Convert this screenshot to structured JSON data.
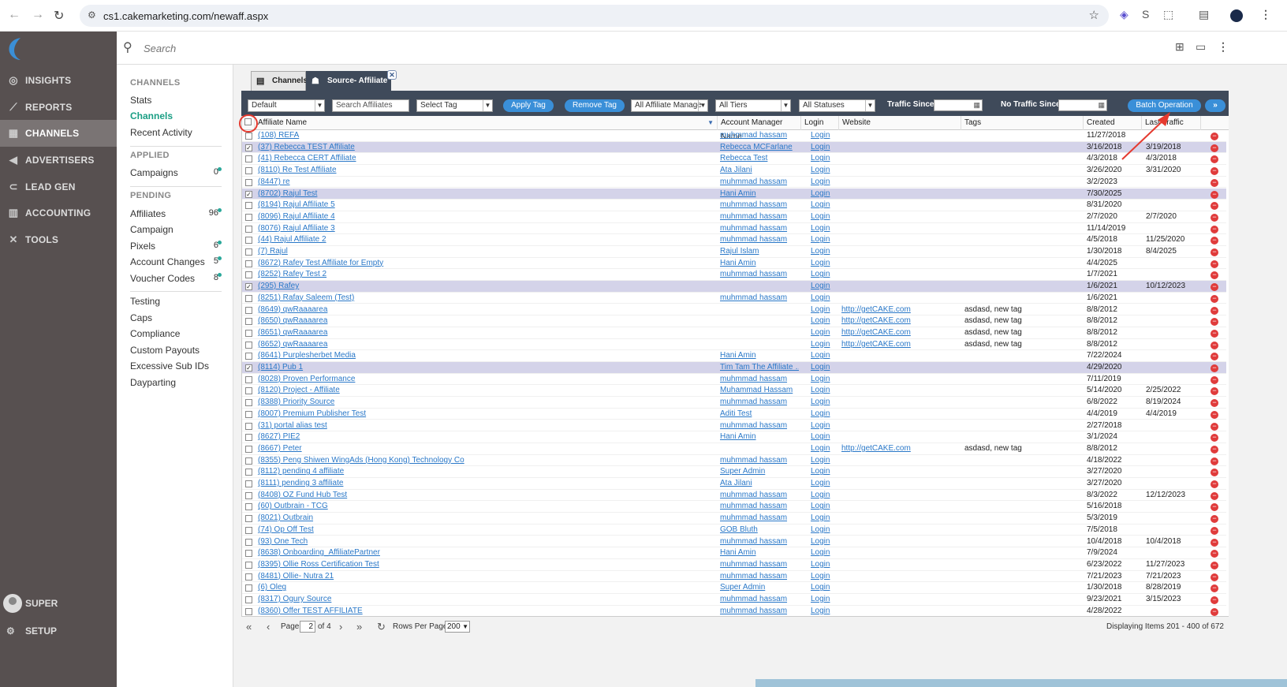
{
  "browser": {
    "url": "cs1.cakemarketing.com/newaff.aspx"
  },
  "sidebar": {
    "items": [
      {
        "label": "INSIGHTS",
        "icon": "insights-icon"
      },
      {
        "label": "REPORTS",
        "icon": "reports-icon"
      },
      {
        "label": "CHANNELS",
        "icon": "channels-icon"
      },
      {
        "label": "ADVERTISERS",
        "icon": "megaphone-icon"
      },
      {
        "label": "LEAD GEN",
        "icon": "magnet-icon"
      },
      {
        "label": "ACCOUNTING",
        "icon": "calculator-icon"
      },
      {
        "label": "TOOLS",
        "icon": "tools-icon"
      }
    ],
    "user": "SUPER",
    "setup": "SETUP"
  },
  "search": {
    "placeholder": "Search"
  },
  "subnav": {
    "channels_head": "CHANNELS",
    "stats": "Stats",
    "channels": "Channels",
    "recent": "Recent Activity",
    "applied_head": "APPLIED",
    "campaigns": "Campaigns",
    "campaigns_count": "0",
    "pending_head": "PENDING",
    "affiliates": "Affiliates",
    "affiliates_count": "96",
    "campaign": "Campaign",
    "pixels": "Pixels",
    "pixels_count": "6",
    "account_changes": "Account Changes",
    "account_changes_count": "5",
    "voucher": "Voucher Codes",
    "voucher_count": "8",
    "testing": "Testing",
    "caps": "Caps",
    "compliance": "Compliance",
    "custom_payouts": "Custom Payouts",
    "excessive": "Excessive Sub IDs",
    "dayparting": "Dayparting"
  },
  "tabs": {
    "channels": "Channels",
    "source": "Source- Affiliate"
  },
  "toolbar": {
    "view": "Default",
    "search_placeholder": "Search Affiliates",
    "select_tag": "Select Tag",
    "apply_tag": "Apply Tag",
    "remove_tag": "Remove Tag",
    "account_manager": "All Affiliate Manage",
    "tiers": "All Tiers",
    "statuses": "All Statuses",
    "traffic_since": "Traffic Since",
    "no_traffic_since": "No Traffic Since",
    "batch": "Batch Operation",
    "more": "»"
  },
  "grid": {
    "headers": {
      "name": "Affiliate Name",
      "manager": "Account Manager Name",
      "login": "Login",
      "website": "Website",
      "tags": "Tags",
      "created": "Created",
      "last": "Last Traffic"
    },
    "rows": [
      {
        "name": "(108) REFA",
        "manager": "muhmmad hassam",
        "login": "Login",
        "website": "",
        "tags": "",
        "created": "11/27/2018",
        "last": "",
        "checked": false
      },
      {
        "name": "(37) Rebecca TEST Affiliate",
        "manager": "Rebecca MCFarlane",
        "login": "Login",
        "website": "",
        "tags": "",
        "created": "3/16/2018",
        "last": "3/19/2018",
        "checked": true
      },
      {
        "name": "(41) Rebecca CERT Affiliate",
        "manager": "Rebecca Test",
        "login": "Login",
        "website": "",
        "tags": "",
        "created": "4/3/2018",
        "last": "4/3/2018",
        "checked": false
      },
      {
        "name": "(8110) Re Test Affiliate",
        "manager": "Ata Jilani",
        "login": "Login",
        "website": "",
        "tags": "",
        "created": "3/26/2020",
        "last": "3/31/2020",
        "checked": false
      },
      {
        "name": "(8447) re",
        "manager": "muhmmad hassam",
        "login": "Login",
        "website": "",
        "tags": "",
        "created": "3/2/2023",
        "last": "",
        "checked": false
      },
      {
        "name": "(8702) Rajul Test",
        "manager": "Hani Amin",
        "login": "Login",
        "website": "",
        "tags": "",
        "created": "7/30/2025",
        "last": "",
        "checked": true
      },
      {
        "name": "(8194) Rajul Affiliate 5",
        "manager": "muhmmad hassam",
        "login": "Login",
        "website": "",
        "tags": "",
        "created": "8/31/2020",
        "last": "",
        "checked": false
      },
      {
        "name": "(8096) Rajul Affiliate 4",
        "manager": "muhmmad hassam",
        "login": "Login",
        "website": "",
        "tags": "",
        "created": "2/7/2020",
        "last": "2/7/2020",
        "checked": false
      },
      {
        "name": "(8076) Rajul Affiliate 3",
        "manager": "muhmmad hassam",
        "login": "Login",
        "website": "",
        "tags": "",
        "created": "11/14/2019",
        "last": "",
        "checked": false
      },
      {
        "name": "(44) Rajul Affiliate 2",
        "manager": "muhmmad hassam",
        "login": "Login",
        "website": "",
        "tags": "",
        "created": "4/5/2018",
        "last": "11/25/2020",
        "checked": false
      },
      {
        "name": "(7) Rajul",
        "manager": "Rajul Islam",
        "login": "Login",
        "website": "",
        "tags": "",
        "created": "1/30/2018",
        "last": "8/4/2025",
        "checked": false
      },
      {
        "name": "(8672) Rafey Test Affiliate for Empty",
        "manager": "Hani Amin",
        "login": "Login",
        "website": "",
        "tags": "",
        "created": "4/4/2025",
        "last": "",
        "checked": false
      },
      {
        "name": "(8252) Rafey Test 2",
        "manager": "muhmmad hassam",
        "login": "Login",
        "website": "",
        "tags": "",
        "created": "1/7/2021",
        "last": "",
        "checked": false
      },
      {
        "name": "(295) Rafey",
        "manager": "",
        "login": "Login",
        "website": "",
        "tags": "",
        "created": "1/6/2021",
        "last": "10/12/2023",
        "checked": true
      },
      {
        "name": "(8251) Rafay Saleem (Test)",
        "manager": "muhmmad hassam",
        "login": "Login",
        "website": "",
        "tags": "",
        "created": "1/6/2021",
        "last": "",
        "checked": false
      },
      {
        "name": "(8649) qwRaaaarea",
        "manager": "",
        "login": "Login",
        "website": "http://getCAKE.com",
        "tags": "asdasd, new tag",
        "created": "8/8/2012",
        "last": "",
        "checked": false
      },
      {
        "name": "(8650) qwRaaaarea",
        "manager": "",
        "login": "Login",
        "website": "http://getCAKE.com",
        "tags": "asdasd, new tag",
        "created": "8/8/2012",
        "last": "",
        "checked": false
      },
      {
        "name": "(8651) qwRaaaarea",
        "manager": "",
        "login": "Login",
        "website": "http://getCAKE.com",
        "tags": "asdasd, new tag",
        "created": "8/8/2012",
        "last": "",
        "checked": false
      },
      {
        "name": "(8652) qwRaaaarea",
        "manager": "",
        "login": "Login",
        "website": "http://getCAKE.com",
        "tags": "asdasd, new tag",
        "created": "8/8/2012",
        "last": "",
        "checked": false
      },
      {
        "name": "(8641) Purplesherbet Media",
        "manager": "Hani Amin",
        "login": "Login",
        "website": "",
        "tags": "",
        "created": "7/22/2024",
        "last": "",
        "checked": false
      },
      {
        "name": "(8114) Pub 1",
        "manager": "Tim Tam The Affiliate …",
        "login": "Login",
        "website": "",
        "tags": "",
        "created": "4/29/2020",
        "last": "",
        "checked": true
      },
      {
        "name": "(8028) Proven Performance",
        "manager": "muhmmad hassam",
        "login": "Login",
        "website": "",
        "tags": "",
        "created": "7/11/2019",
        "last": "",
        "checked": false
      },
      {
        "name": "(8120) Project - Affiliate",
        "manager": "Muhammad Hassam",
        "login": "Login",
        "website": "",
        "tags": "",
        "created": "5/14/2020",
        "last": "2/25/2022",
        "checked": false
      },
      {
        "name": "(8388) Priority Source",
        "manager": "muhmmad hassam",
        "login": "Login",
        "website": "",
        "tags": "",
        "created": "6/8/2022",
        "last": "8/19/2024",
        "checked": false
      },
      {
        "name": "(8007) Premium Publisher Test",
        "manager": "Aditi Test",
        "login": "Login",
        "website": "",
        "tags": "",
        "created": "4/4/2019",
        "last": "4/4/2019",
        "checked": false
      },
      {
        "name": "(31) portal alias test",
        "manager": "muhmmad hassam",
        "login": "Login",
        "website": "",
        "tags": "",
        "created": "2/27/2018",
        "last": "",
        "checked": false
      },
      {
        "name": "(8627) PIE2",
        "manager": "Hani Amin",
        "login": "Login",
        "website": "",
        "tags": "",
        "created": "3/1/2024",
        "last": "",
        "checked": false
      },
      {
        "name": "(8667) Peter",
        "manager": "",
        "login": "Login",
        "website": "http://getCAKE.com",
        "tags": "asdasd, new tag",
        "created": "8/8/2012",
        "last": "",
        "checked": false
      },
      {
        "name": "(8355) Peng Shiwen WingAds (Hong Kong) Technology Co",
        "manager": "muhmmad hassam",
        "login": "Login",
        "website": "",
        "tags": "",
        "created": "4/18/2022",
        "last": "",
        "checked": false
      },
      {
        "name": "(8112) pending 4 affiliate",
        "manager": "Super Admin",
        "login": "Login",
        "website": "",
        "tags": "",
        "created": "3/27/2020",
        "last": "",
        "checked": false
      },
      {
        "name": "(8111) pending 3 affiliate",
        "manager": "Ata Jilani",
        "login": "Login",
        "website": "",
        "tags": "",
        "created": "3/27/2020",
        "last": "",
        "checked": false
      },
      {
        "name": "(8408) OZ Fund Hub Test",
        "manager": "muhmmad hassam",
        "login": "Login",
        "website": "",
        "tags": "",
        "created": "8/3/2022",
        "last": "12/12/2023",
        "checked": false
      },
      {
        "name": "(60) Outbrain - TCG",
        "manager": "muhmmad hassam",
        "login": "Login",
        "website": "",
        "tags": "",
        "created": "5/16/2018",
        "last": "",
        "checked": false
      },
      {
        "name": "(8021) Outbrain",
        "manager": "muhmmad hassam",
        "login": "Login",
        "website": "",
        "tags": "",
        "created": "5/3/2019",
        "last": "",
        "checked": false
      },
      {
        "name": "(74) Op Off Test",
        "manager": "GOB Bluth",
        "login": "Login",
        "website": "",
        "tags": "",
        "created": "7/5/2018",
        "last": "",
        "checked": false
      },
      {
        "name": "(93) One Tech",
        "manager": "muhmmad hassam",
        "login": "Login",
        "website": "",
        "tags": "",
        "created": "10/4/2018",
        "last": "10/4/2018",
        "checked": false
      },
      {
        "name": "(8638) Onboarding_AffiliatePartner",
        "manager": "Hani Amin",
        "login": "Login",
        "website": "",
        "tags": "",
        "created": "7/9/2024",
        "last": "",
        "checked": false
      },
      {
        "name": "(8395) Ollie Ross Certification Test",
        "manager": "muhmmad hassam",
        "login": "Login",
        "website": "",
        "tags": "",
        "created": "6/23/2022",
        "last": "11/27/2023",
        "checked": false
      },
      {
        "name": "(8481) Ollie- Nutra 21",
        "manager": "muhmmad hassam",
        "login": "Login",
        "website": "",
        "tags": "",
        "created": "7/21/2023",
        "last": "7/21/2023",
        "checked": false
      },
      {
        "name": "(6) Oleg",
        "manager": "Super Admin",
        "login": "Login",
        "website": "",
        "tags": "",
        "created": "1/30/2018",
        "last": "8/28/2019",
        "checked": false
      },
      {
        "name": "(8317) Ogury Source",
        "manager": "muhmmad hassam",
        "login": "Login",
        "website": "",
        "tags": "",
        "created": "9/23/2021",
        "last": "3/15/2023",
        "checked": false
      },
      {
        "name": "(8360) Offer TEST AFFILIATE",
        "manager": "muhmmad hassam",
        "login": "Login",
        "website": "",
        "tags": "",
        "created": "4/28/2022",
        "last": "",
        "checked": false
      }
    ]
  },
  "pager": {
    "page_label": "Page",
    "page": "2",
    "of": "of 4",
    "rows_label": "Rows Per Page:",
    "rows": "200",
    "displaying": "Displaying Items 201 - 400 of 672"
  }
}
